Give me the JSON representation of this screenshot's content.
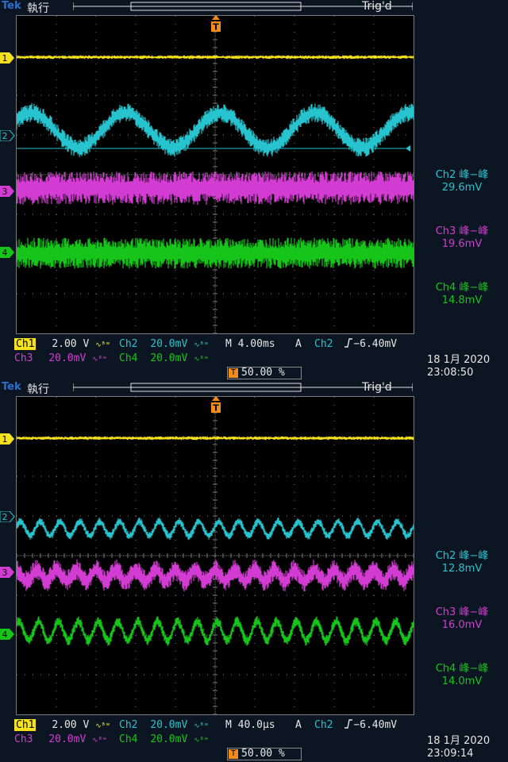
{
  "colors": {
    "ch1": "#f5e21c",
    "ch2": "#27c4cf",
    "ch3": "#d33cd2",
    "ch4": "#16c41a",
    "trigger": "#f08b1c",
    "grid": "#7a7a7a"
  },
  "icons": [
    "trigger-marker-icon",
    "edge-rising-icon",
    "coupling-icon",
    "channel-marker-icon"
  ],
  "screens": [
    {
      "brand": "Tek",
      "run_state": "執行",
      "trigger_status": "Trig'd",
      "trigger_marker": "T",
      "channel_markers": [
        "1",
        "2",
        "3",
        "4"
      ],
      "measurements": [
        {
          "label": "Ch2 峰−峰",
          "value": "29.6mV"
        },
        {
          "label": "Ch3 峰−峰",
          "value": "19.6mV"
        },
        {
          "label": "Ch4 峰−峰",
          "value": "14.8mV"
        }
      ],
      "status": {
        "ch1_label": "Ch1",
        "ch1_scale": "2.00 V",
        "ch2_label": "Ch2",
        "ch2_scale": "20.0mV",
        "ch3_label": "Ch3",
        "ch3_scale": "20.0mV",
        "ch4_label": "Ch4",
        "ch4_scale": "20.0mV",
        "bw_mark": "∿ᴮʷ",
        "timebase": "M 4.00ms",
        "mode": "A",
        "trigger_source": "Ch2",
        "trigger_level": "−6.40mV",
        "trigger_position": "50.00 %",
        "date": "18 1月  2020",
        "time": "23:08:50"
      },
      "waveforms": {
        "ch2_periods": 4.2,
        "ch3_periods": 0,
        "ch4_periods": 0
      }
    },
    {
      "brand": "Tek",
      "run_state": "執行",
      "trigger_status": "Trig'd",
      "trigger_marker": "T",
      "channel_markers": [
        "1",
        "2",
        "3",
        "4"
      ],
      "measurements": [
        {
          "label": "Ch2 峰−峰",
          "value": "12.8mV"
        },
        {
          "label": "Ch3 峰−峰",
          "value": "16.0mV"
        },
        {
          "label": "Ch4 峰−峰",
          "value": "14.0mV"
        }
      ],
      "status": {
        "ch1_label": "Ch1",
        "ch1_scale": "2.00 V",
        "ch2_label": "Ch2",
        "ch2_scale": "20.0mV",
        "ch3_label": "Ch3",
        "ch3_scale": "20.0mV",
        "ch4_label": "Ch4",
        "ch4_scale": "20.0mV",
        "bw_mark": "∿ᴮʷ",
        "timebase": "M 40.0µs",
        "mode": "A",
        "trigger_source": "Ch2",
        "trigger_level": "−6.40mV",
        "trigger_position": "50.00 %",
        "date": "18 1月  2020",
        "time": "23:09:14"
      },
      "waveforms": {
        "ch2_periods": 20,
        "ch3_periods": 20,
        "ch4_periods": 20
      }
    }
  ]
}
